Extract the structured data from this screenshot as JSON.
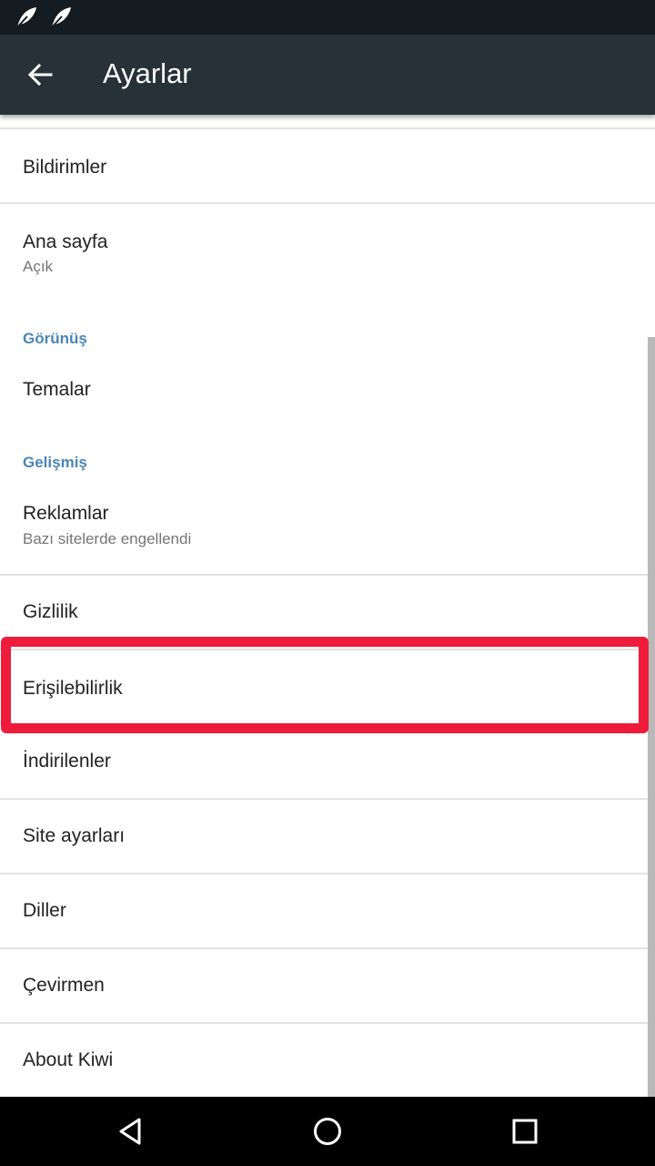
{
  "app_bar": {
    "title": "Ayarlar",
    "back_icon": "arrow-left-icon"
  },
  "status_bar": {
    "icons": [
      "leaf-icon",
      "leaf-icon"
    ]
  },
  "settings": {
    "bildirimler": "Bildirimler",
    "ana_sayfa": {
      "label": "Ana sayfa",
      "summary": "Açık"
    },
    "section_gorunus": "Görünüş",
    "temalar": "Temalar",
    "section_gelismis": "Gelişmiş",
    "reklamlar": {
      "label": "Reklamlar",
      "summary": "Bazı sitelerde engellendi"
    },
    "gizlilik": "Gizlilik",
    "erisilebilirlik": "Erişilebilirlik",
    "indirilenler": "İndirilenler",
    "site_ayarlari": "Site ayarları",
    "diller": "Diller",
    "cevirmen": "Çevirmen",
    "about": "About Kiwi"
  },
  "highlight": {
    "target": "Erişilebilirlik",
    "color": "#ee1b3a"
  },
  "colors": {
    "app_bar": "#263238",
    "status_bar": "#141c21",
    "section_header": "#4a86b6",
    "nav_bar": "#000000"
  },
  "nav_bar": {
    "back": "triangle-back-icon",
    "home": "circle-home-icon",
    "recents": "square-recents-icon"
  }
}
